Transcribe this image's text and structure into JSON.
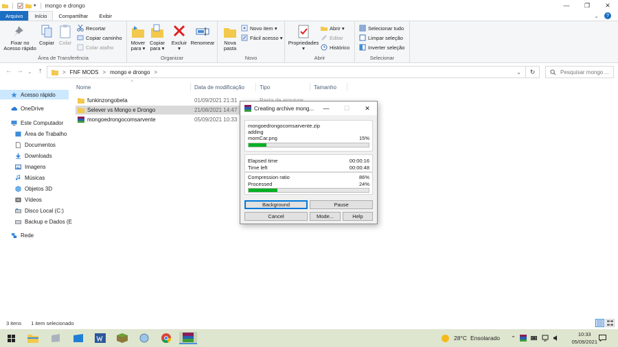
{
  "window": {
    "title": "mongo e drongo",
    "controls": {
      "minimize": "—",
      "maximize": "❐",
      "close": "✕"
    }
  },
  "ribbon_tabs": [
    {
      "label": "Arquivo"
    },
    {
      "label": "Início"
    },
    {
      "label": "Compartilhar"
    },
    {
      "label": "Exibir"
    }
  ],
  "ribbon_right": {
    "collapse": "⌄",
    "help": "?"
  },
  "ribbon": {
    "groups": {
      "clipboard": "Área de Transferência",
      "organize": "Organizar",
      "new": "Novo",
      "open": "Abrir",
      "select": "Selecionar"
    },
    "pin_label_1": "Fixar no",
    "pin_label_2": "Acesso rápido",
    "copy_label": "Copiar",
    "paste_label": "Colar",
    "cut_label": "Recortar",
    "copy_path_label": "Copiar caminho",
    "paste_shortcut_label": "Colar atalho",
    "move_to_1": "Mover",
    "move_to_2": "para ▾",
    "copy_to_1": "Copiar",
    "copy_to_2": "para ▾",
    "delete_1": "Excluir",
    "delete_2": "▾",
    "rename_label": "Renomear",
    "new_folder_1": "Nova",
    "new_folder_2": "pasta",
    "new_item_label": "Novo item ▾",
    "easy_access_label": "Fácil acesso ▾",
    "properties_1": "Propriedades",
    "properties_2": "▾",
    "open_label": "Abrir ▾",
    "edit_label": "Editar",
    "history_label": "Histórico",
    "select_all_label": "Selecionar tudo",
    "select_none_label": "Limpar seleção",
    "invert_selection_label": "Inverter seleção"
  },
  "address": {
    "back": "←",
    "forward": "→",
    "recent": "⌄",
    "up": "↑",
    "sep1": ">",
    "part1": "FNF MODS",
    "sep2": ">",
    "part2": "mongo e drongo",
    "sep3": ">",
    "dropdown": "⌄",
    "refresh": "↻",
    "search_placeholder": "Pesquisar mongo ..."
  },
  "nav_pane": {
    "quick_access": "Acesso rápido",
    "onedrive": "OneDrive",
    "this_pc": "Este Computador",
    "desktop": "Área de Trabalho",
    "documents": "Documentos",
    "downloads": "Downloads",
    "pictures": "Imagens",
    "music": "Músicas",
    "objects3d": "Objetos 3D",
    "videos": "Vídeos",
    "local_disk": "Disco Local (C:)",
    "backup_disk": "Backup e Dados (E",
    "network": "Rede"
  },
  "file_list": {
    "columns": {
      "name": "Nome",
      "date": "Data de modificação",
      "type": "Tipo",
      "size": "Tamanho"
    },
    "sort_arrow": "^",
    "bg_type": "Pasta de arquivos",
    "rows": [
      {
        "name": "funkinzongobeta",
        "date": "01/09/2021 21:31"
      },
      {
        "name": "Selever vs Mongo e Drongo",
        "date": "21/08/2021 14:47"
      },
      {
        "name": "mongoedrongocomsarvente",
        "date": "05/09/2021 10:33"
      }
    ]
  },
  "status_bar": {
    "items": "3 itens",
    "selected": "1 item selecionado"
  },
  "dialog": {
    "title": "Creating archive mong...",
    "archive": "mongoedrongocomsarvente.zip",
    "action": "adding",
    "file": "momCar.png",
    "file_percent": "15%",
    "file_progress": 0.15,
    "elapsed_label": "Elapsed time",
    "elapsed_value": "00:00:16",
    "timeleft_label": "Time left",
    "timeleft_value": "00:00:48",
    "ratio_label": "Compression ratio",
    "ratio_value": "86%",
    "processed_label": "Processed",
    "processed_value": "24%",
    "processed_progress": 0.24,
    "btn_background": "Background",
    "btn_pause": "Pause",
    "btn_cancel": "Cancel",
    "btn_mode": "Mode...",
    "btn_help": "Help",
    "ctl_min": "—",
    "ctl_max": "☐",
    "ctl_close": "✕"
  },
  "taskbar": {
    "weather_temp": "28°C",
    "weather_text": "Ensolarado",
    "tray_icons": "⌃",
    "time": "10:33",
    "date": "05/09/2021"
  }
}
